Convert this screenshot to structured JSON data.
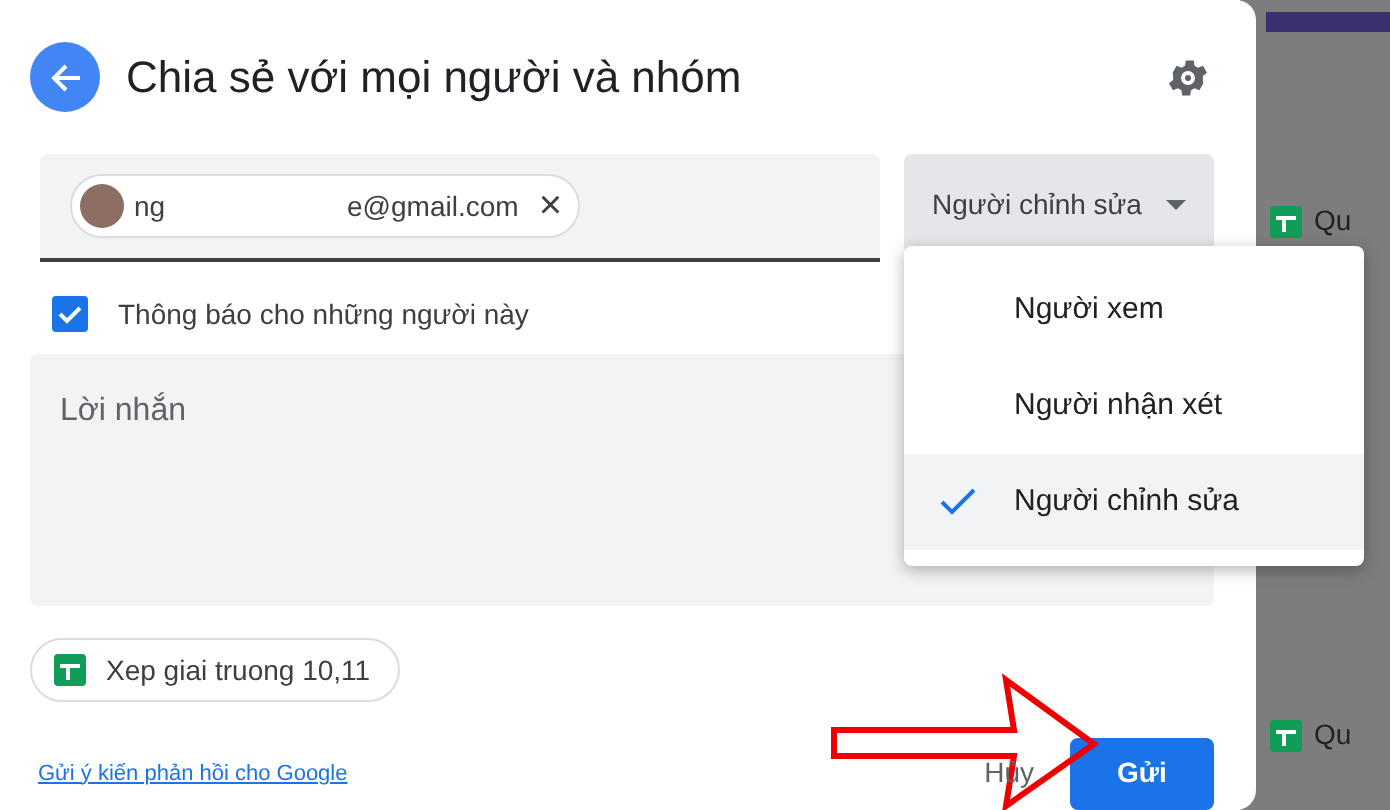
{
  "dialog": {
    "title": "Chia sẻ với mọi người và nhóm"
  },
  "recipient_chip": {
    "name_start": "ng",
    "name_end": "e@gmail.com",
    "remove": "×"
  },
  "role_dropdown": {
    "value": "Người chỉnh sửa",
    "expanded": true
  },
  "role_menu": [
    {
      "label": "Người xem",
      "selected": false
    },
    {
      "label": "Người nhận xét",
      "selected": false
    },
    {
      "label": "Người chỉnh sửa",
      "selected": true
    }
  ],
  "notify": {
    "label": "Thông báo cho những người này",
    "checked": true
  },
  "message": {
    "placeholder": "Lời nhắn"
  },
  "file_chip": {
    "label": "Xep giai truong 10,11"
  },
  "feedback_link": "Gửi ý kiến phản hồi cho Google",
  "buttons": [
    {
      "label": "Hủy",
      "kind": "text"
    },
    {
      "label": "Gửi",
      "kind": "primary"
    }
  ],
  "background_sheet": [
    {
      "text": "Qu"
    },
    {
      "text": "Qu"
    }
  ]
}
